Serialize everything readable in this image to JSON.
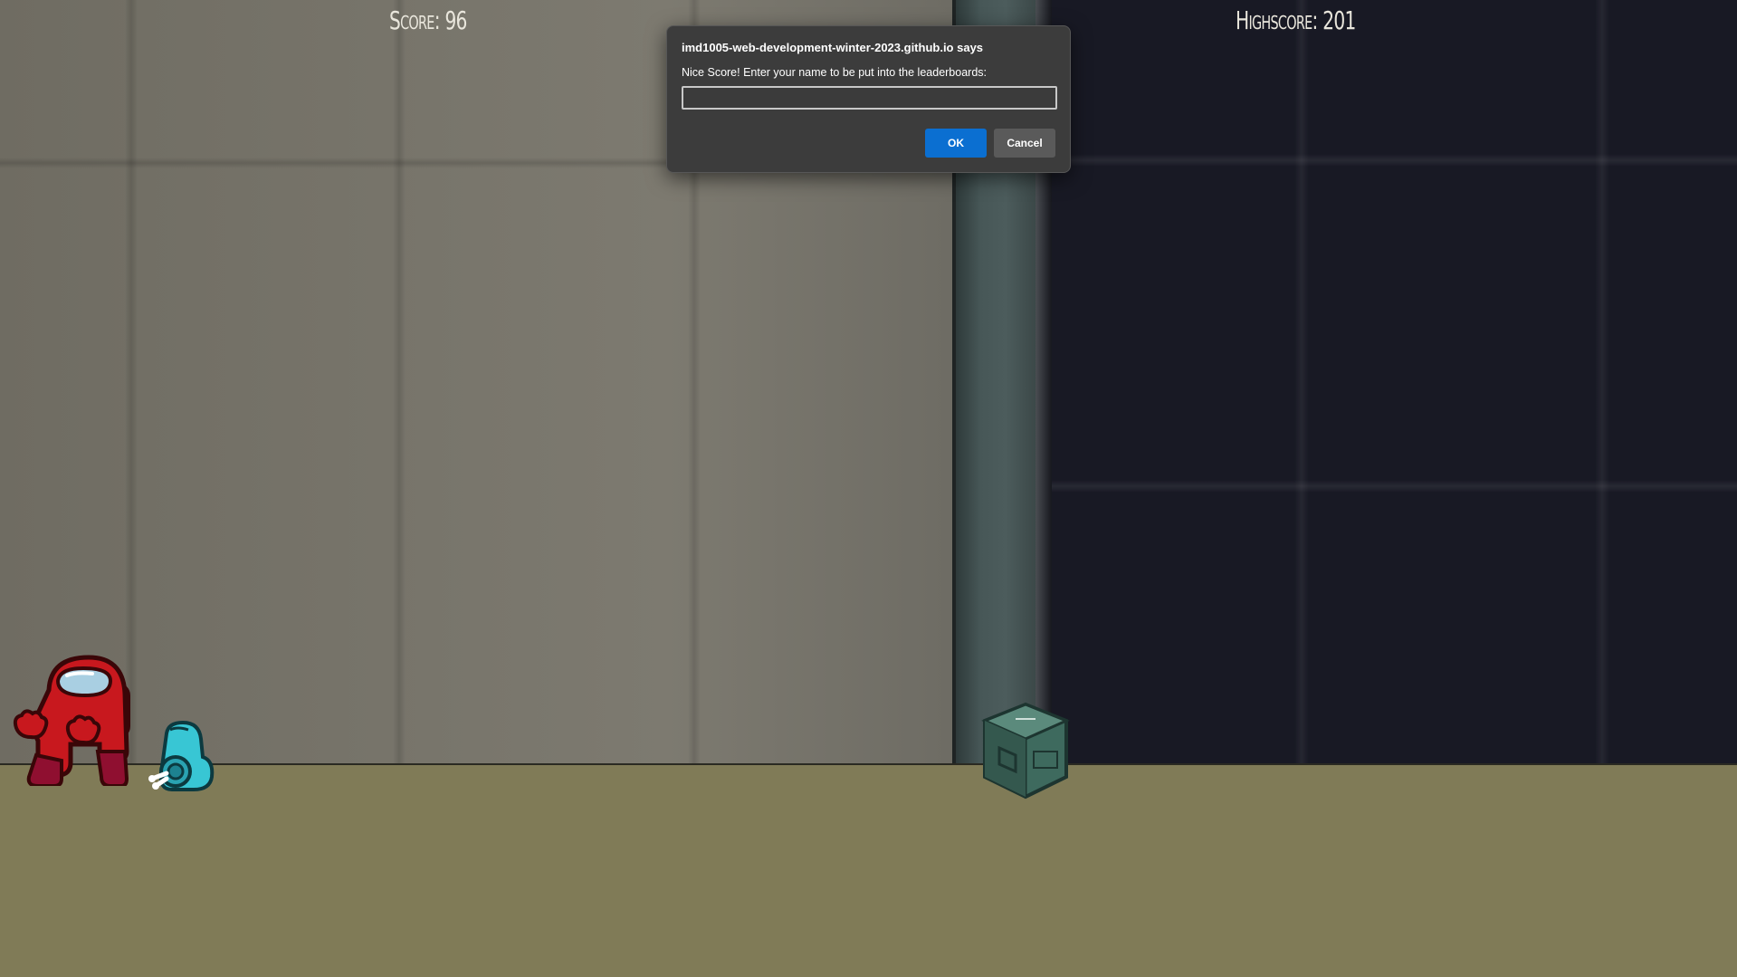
{
  "hud": {
    "score_label": "Score: 96",
    "highscore_label": "Highscore: 201"
  },
  "dialog": {
    "title": "imd1005-web-development-winter-2023.github.io says",
    "message": "Nice Score! Enter your name to be put into the leaderboards:",
    "input_value": "",
    "ok_label": "OK",
    "cancel_label": "Cancel"
  },
  "sprites": {
    "player": "red-crewmate-icon",
    "pet": "cyan-mini-crewmate-icon",
    "obstacle": "green-crate-icon"
  },
  "colors": {
    "ok_button": "#0b6fd1",
    "player": "#c8181e",
    "pet": "#38c6d4",
    "crate": "#3e6a5e"
  }
}
